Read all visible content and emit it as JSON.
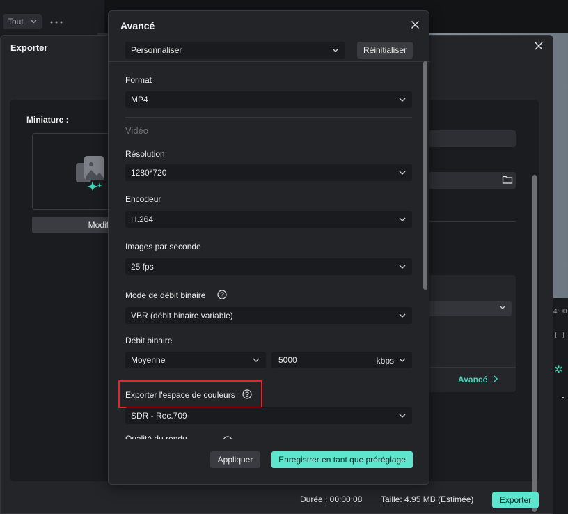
{
  "background": {
    "filter_chip": "Tout",
    "right_strip_text": "4:00"
  },
  "export": {
    "title": "Exporter",
    "thumbnail_label": "Miniature :",
    "modify_button": "Modif",
    "advanced_link": "Avancé",
    "duration": "Durée : 00:00:08",
    "size": "Taille: 4.95 MB (Estimée)",
    "export_button": "Exporter"
  },
  "modal": {
    "title": "Avancé",
    "preset": "Personnaliser",
    "reset_button": "Réinitialiser",
    "format_label": "Format",
    "format_value": "MP4",
    "video_section": "Vidéo",
    "resolution_label": "Résolution",
    "resolution_value": "1280*720",
    "encoder_label": "Encodeur",
    "encoder_value": "H.264",
    "fps_label": "Images par seconde",
    "fps_value": "25 fps",
    "bitrate_mode_label": "Mode de débit binaire",
    "bitrate_mode_value": "VBR (débit binaire variable)",
    "bitrate_label": "Débit binaire",
    "bitrate_quality": "Moyenne",
    "bitrate_value": "5000",
    "bitrate_unit": "kbps",
    "color_space_label": "Exporter l'espace de couleurs",
    "color_space_value": "SDR - Rec.709",
    "cut_label": "Qualité du rendu",
    "apply_button": "Appliquer",
    "save_preset_button": "Enregistrer en tant que préréglage"
  },
  "colors": {
    "accent": "#5de6cd",
    "highlight": "#e4232a"
  }
}
